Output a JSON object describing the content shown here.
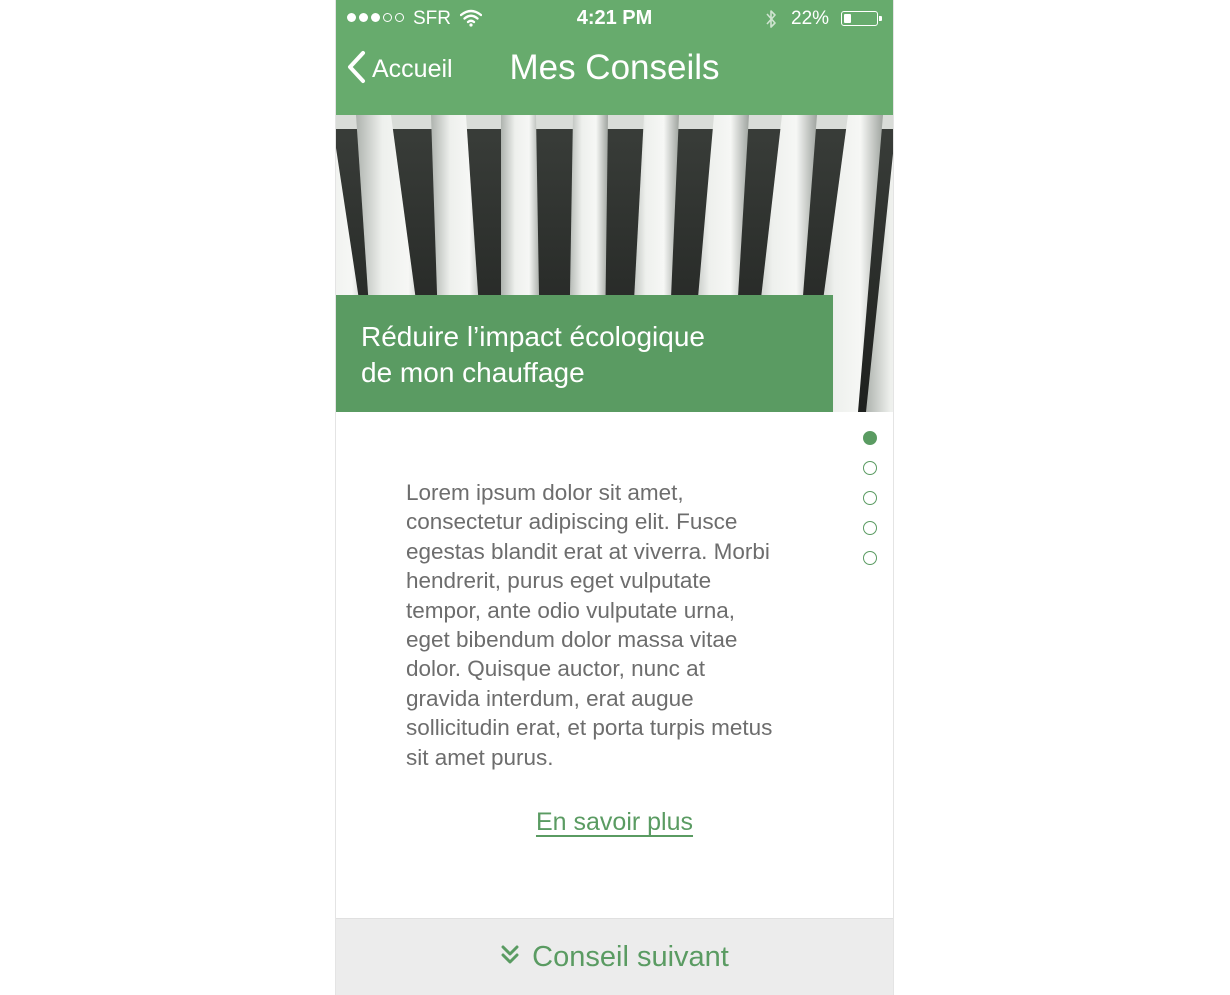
{
  "status_bar": {
    "carrier": "SFR",
    "time": "4:21 PM",
    "battery_percent": "22%",
    "battery_level": 0.22,
    "signal_bars_filled": 3,
    "signal_bars_total": 5
  },
  "nav": {
    "back_label": "Accueil",
    "title": "Mes Conseils"
  },
  "hero": {
    "title_line1": "Réduire l’impact écologique",
    "title_line2": "de mon chauffage",
    "image": "radiator-photo"
  },
  "pagination": {
    "total": 5,
    "active": 1
  },
  "content": {
    "lines": [
      "Lorem ipsum dolor sit amet,",
      "consectetur adipiscing elit. Fusce",
      "egestas blandit erat at viverra. Morbi",
      "hendrerit, purus eget vulputate",
      "tempor, ante odio vulputate urna,",
      "eget bibendum dolor massa vitae",
      "dolor. Quisque auctor, nunc at",
      "gravida interdum, erat augue",
      "sollicitudin erat, et porta turpis metus",
      "sit amet purus."
    ],
    "link_label": "En savoir plus"
  },
  "footer": {
    "next_label": "Conseil suivant",
    "icon": "chevron-double-down-icon"
  },
  "colors": {
    "brand_green": "#67ab6d",
    "accent_green": "#5a9b62",
    "text_gray": "#6d6d6d"
  }
}
